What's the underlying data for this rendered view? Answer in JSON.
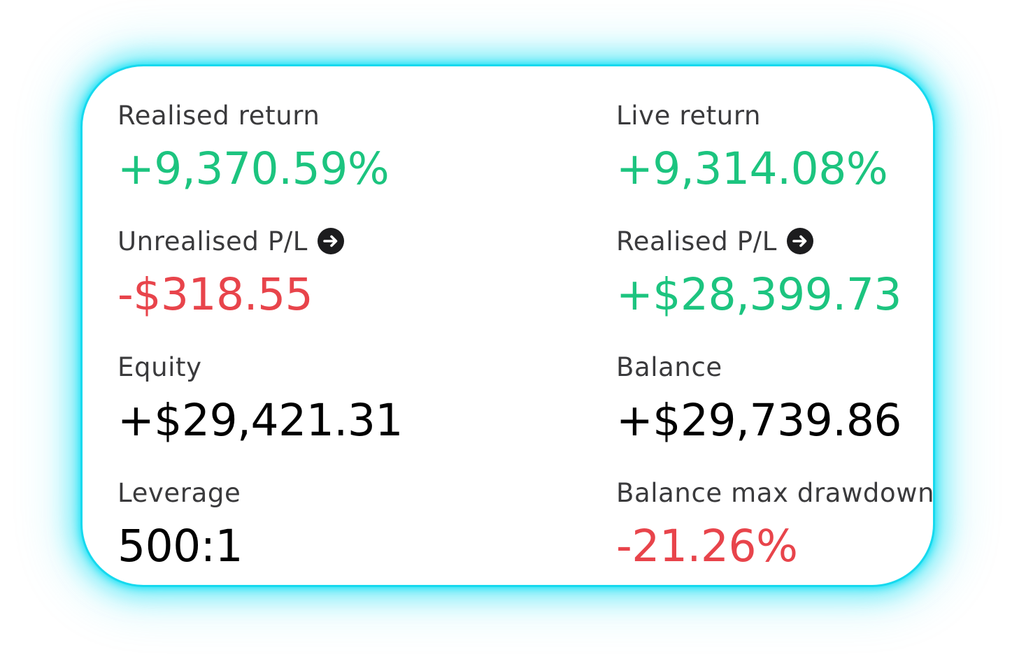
{
  "metrics": {
    "realised_return": {
      "label": "Realised return",
      "value": "+9,370.59%"
    },
    "live_return": {
      "label": "Live return",
      "value": "+9,314.08%"
    },
    "unrealised_pl": {
      "label": "Unrealised P/L",
      "value": "-$318.55",
      "icon": "arrow-right-circle-icon"
    },
    "realised_pl": {
      "label": "Realised P/L",
      "value": "+$28,399.73",
      "icon": "arrow-right-circle-icon"
    },
    "equity": {
      "label": "Equity",
      "value": "+$29,421.31"
    },
    "balance": {
      "label": "Balance",
      "value": "+$29,739.86"
    },
    "leverage": {
      "label": "Leverage",
      "value": "500:1"
    },
    "balance_max_drawdown": {
      "label": "Balance max drawdown",
      "value": "-21.26%"
    }
  },
  "colors": {
    "positive": "#1cc47f",
    "negative": "#e8444b",
    "neutral": "#000000",
    "label": "#3a3a3c",
    "card_glow": "#16d9ee"
  }
}
